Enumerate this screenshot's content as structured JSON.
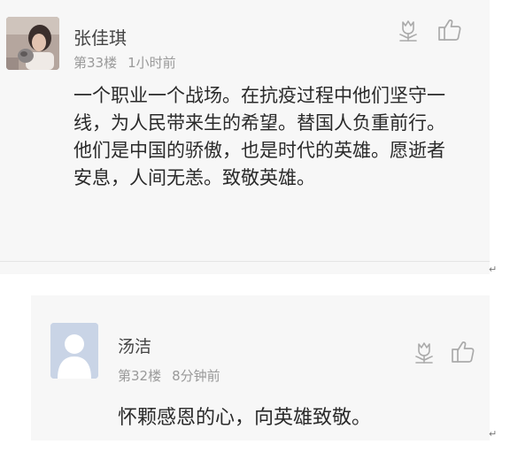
{
  "comments": [
    {
      "username": "张佳琪",
      "floor": "第33楼",
      "time": "1小时前",
      "text": "一个职业一个战场。在抗疫过程中他们坚守一线，为人民带来生的希望。替国人负重前行。他们是中国的骄傲，也是时代的英雄。愿逝者安息，人间无恙。致敬英雄。",
      "avatar": "user-photo"
    },
    {
      "username": "汤洁",
      "floor": "第32楼",
      "time": "8分钟前",
      "text": "怀颗感恩的心，向英雄致敬。",
      "avatar": "default-user-silhouette"
    }
  ],
  "icons": {
    "flower": "flower-icon",
    "like": "thumbs-up-icon"
  },
  "colors": {
    "card_background": "#f7f7f7",
    "meta_text": "#999999",
    "icon_stroke": "#aaaaaa",
    "default_avatar_bg": "#c7d3e6"
  },
  "paragraph_mark": "↵"
}
